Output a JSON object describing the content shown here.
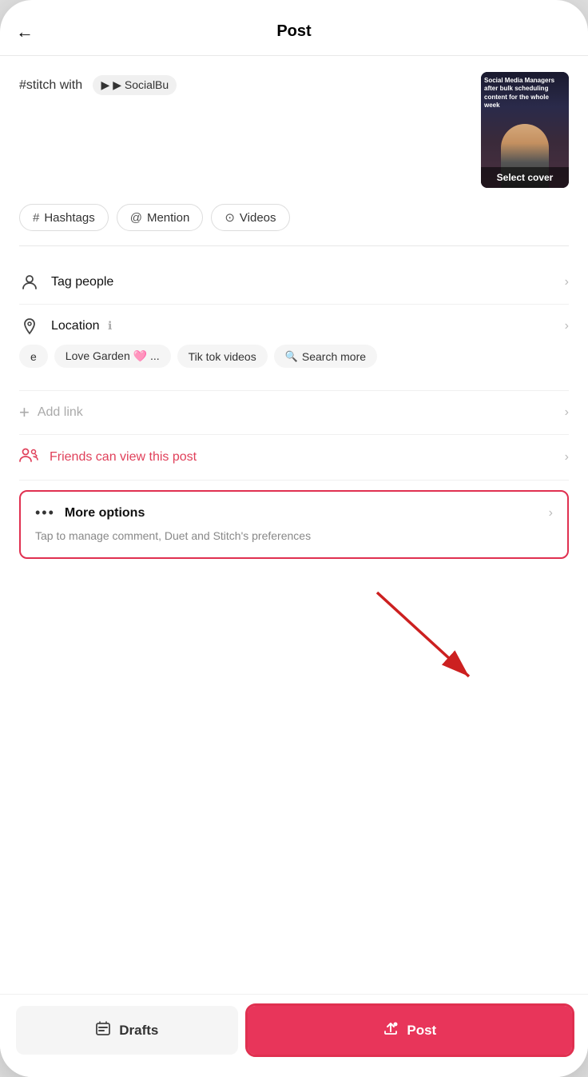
{
  "header": {
    "back_label": "←",
    "title": "Post"
  },
  "caption": {
    "text_prefix": "#stitch with",
    "badge_label": "▶ SocialBu"
  },
  "video": {
    "select_cover_label": "Select cover",
    "thumb_text": "Social Media Managers after bulk scheduling content for the whole week"
  },
  "tags": [
    {
      "icon": "#",
      "label": "Hashtags"
    },
    {
      "icon": "@",
      "label": "Mention"
    },
    {
      "icon": "⊙",
      "label": "Videos"
    }
  ],
  "menu": {
    "tag_people": {
      "label": "Tag people",
      "icon": "person"
    },
    "location": {
      "label": "Location",
      "icon": "pin",
      "info_icon": "ℹ"
    }
  },
  "location_chips": [
    {
      "label": "e",
      "has_search": false
    },
    {
      "label": "Love Garden 🩷 ...",
      "has_search": false
    },
    {
      "label": "Tik tok videos",
      "has_search": false
    },
    {
      "label": "Search more",
      "has_search": true
    }
  ],
  "add_link": {
    "label": "Add link",
    "icon": "+"
  },
  "friends_view": {
    "label": "Friends can view this post",
    "icon": "friends"
  },
  "more_options": {
    "label": "More options",
    "dots": "•••",
    "description": "Tap to manage comment, Duet and Stitch's preferences"
  },
  "bottom": {
    "drafts_label": "Drafts",
    "post_label": "Post",
    "drafts_icon": "archive",
    "post_icon": "upload-star"
  }
}
